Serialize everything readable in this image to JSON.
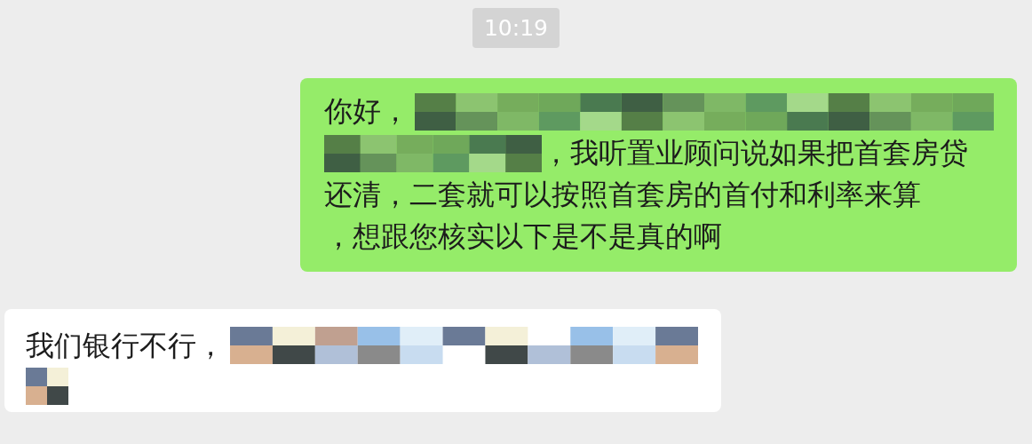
{
  "timestamp": "10:19",
  "messages": [
    {
      "kind": "sent",
      "lines": [
        [
          {
            "kind": "text",
            "text": "你好，"
          },
          {
            "kind": "redacted"
          }
        ],
        [
          {
            "kind": "redacted"
          },
          {
            "kind": "text",
            "text": "，我听置业顾问说如果把首套房贷"
          }
        ],
        [
          {
            "kind": "text",
            "text": "还清，二套就可以按照首套房的首付和利率来算"
          }
        ],
        [
          {
            "kind": "text",
            "text": "，想跟您核实以下是不是真的啊"
          }
        ]
      ]
    },
    {
      "kind": "received",
      "lines": [
        [
          {
            "kind": "text",
            "text": "我们银行不行，"
          },
          {
            "kind": "redacted"
          }
        ],
        [
          {
            "kind": "redacted"
          }
        ]
      ]
    }
  ]
}
